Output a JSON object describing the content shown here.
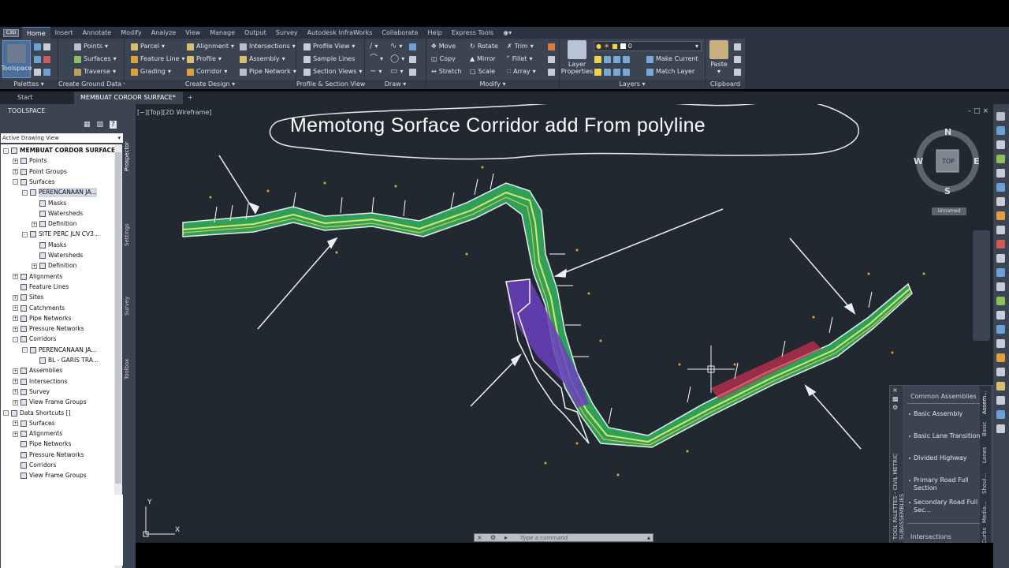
{
  "app_button": "C3D",
  "ribbon_tabs": [
    "Home",
    "Insert",
    "Annotate",
    "Modify",
    "Analyze",
    "View",
    "Manage",
    "Output",
    "Survey",
    "Autodesk InfraWorks",
    "Collaborate",
    "Help",
    "Express Tools"
  ],
  "ribbon": {
    "toolspace": "Toolspace",
    "palettes_title": "Palettes",
    "ground": {
      "title": "Create Ground Data",
      "points": "Points",
      "surfaces": "Surfaces",
      "traverse": "Traverse"
    },
    "design": {
      "title": "Create Design",
      "parcel": "Parcel",
      "feature_line": "Feature Line",
      "grading": "Grading",
      "alignment": "Alignment",
      "profile": "Profile",
      "corridor": "Corridor",
      "intersections": "Intersections",
      "assembly": "Assembly",
      "pipe_network": "Pipe Network"
    },
    "psv": {
      "title": "Profile & Section Views",
      "profile_view": "Profile View",
      "sample_lines": "Sample Lines",
      "section_views": "Section Views"
    },
    "draw": {
      "title": "Draw"
    },
    "modify": {
      "title": "Modify",
      "move": "Move",
      "rotate": "Rotate",
      "trim": "Trim",
      "copy": "Copy",
      "mirror": "Mirror",
      "fillet": "Fillet",
      "stretch": "Stretch",
      "scale": "Scale",
      "array": "Array"
    },
    "layers": {
      "title": "Layers",
      "layer_properties": "Layer Properties",
      "current_layer": "0",
      "make_current": "Make Current",
      "match_layer": "Match Layer"
    },
    "clipboard": {
      "title": "Clipboard",
      "paste": "Paste"
    }
  },
  "doc_tabs": [
    "Start",
    "MEMBUAT CORDOR SURFACE*"
  ],
  "toolspace": {
    "title": "TOOLSPACE",
    "view_select": "Active Drawing View",
    "side_tabs": [
      "Prospector",
      "Settings",
      "Survey",
      "Toolbox"
    ],
    "tree": [
      {
        "label": "MEMBUAT CORDOR SURFACE",
        "level": 0,
        "exp": "-",
        "bold": true
      },
      {
        "label": "Points",
        "level": 1,
        "exp": "+"
      },
      {
        "label": "Point Groups",
        "level": 1,
        "exp": "+"
      },
      {
        "label": "Surfaces",
        "level": 1,
        "exp": "-"
      },
      {
        "label": "PERENCANAAN JA...",
        "level": 2,
        "exp": "-",
        "sel": true
      },
      {
        "label": "Masks",
        "level": 3,
        "exp": ""
      },
      {
        "label": "Watersheds",
        "level": 3,
        "exp": ""
      },
      {
        "label": "Definition",
        "level": 3,
        "exp": "+"
      },
      {
        "label": "SITE PERC JLN CV3...",
        "level": 2,
        "exp": "-"
      },
      {
        "label": "Masks",
        "level": 3,
        "exp": ""
      },
      {
        "label": "Watersheds",
        "level": 3,
        "exp": ""
      },
      {
        "label": "Definition",
        "level": 3,
        "exp": "+"
      },
      {
        "label": "Alignments",
        "level": 1,
        "exp": "+"
      },
      {
        "label": "Feature Lines",
        "level": 1,
        "exp": ""
      },
      {
        "label": "Sites",
        "level": 1,
        "exp": "+"
      },
      {
        "label": "Catchments",
        "level": 1,
        "exp": "+"
      },
      {
        "label": "Pipe Networks",
        "level": 1,
        "exp": "+"
      },
      {
        "label": "Pressure Networks",
        "level": 1,
        "exp": "+"
      },
      {
        "label": "Corridors",
        "level": 1,
        "exp": "-"
      },
      {
        "label": "PERENCANAAN JA...",
        "level": 2,
        "exp": "-"
      },
      {
        "label": "BL - GARIS TRA...",
        "level": 3,
        "exp": ""
      },
      {
        "label": "Assemblies",
        "level": 1,
        "exp": "+"
      },
      {
        "label": "Intersections",
        "level": 1,
        "exp": "+"
      },
      {
        "label": "Survey",
        "level": 1,
        "exp": "+"
      },
      {
        "label": "View Frame Groups",
        "level": 1,
        "exp": "+"
      },
      {
        "label": "Data Shortcuts []",
        "level": 0,
        "exp": "-"
      },
      {
        "label": "Surfaces",
        "level": 1,
        "exp": "+"
      },
      {
        "label": "Alignments",
        "level": 1,
        "exp": "+"
      },
      {
        "label": "Pipe Networks",
        "level": 1,
        "exp": ""
      },
      {
        "label": "Pressure Networks",
        "level": 1,
        "exp": ""
      },
      {
        "label": "Corridors",
        "level": 1,
        "exp": ""
      },
      {
        "label": "View Frame Groups",
        "level": 1,
        "exp": ""
      }
    ]
  },
  "viewport": {
    "label": "[−][Top][2D Wireframe]",
    "annotation": "Memotong Sorface Corridor add From polyline",
    "viewcube": {
      "n": "N",
      "s": "S",
      "e": "E",
      "w": "W",
      "top": "TOP",
      "ucs": "Unnamed"
    },
    "ucs_y": "Y",
    "ucs_x": "X"
  },
  "tool_palette": {
    "side_label": "TOOL PALETTES - CIVIL METRIC SUBASSEMBLIES",
    "heading": "Common Assemblies",
    "items": [
      "Basic Assembly",
      "Basic Lane Transition",
      "Divided Highway",
      "Primary Road Full Section",
      "Secondary Road Full Sec..."
    ],
    "tabs": [
      "Assem...",
      "Basic",
      "Lanes",
      "Shoul...",
      "Media...",
      "Curbs"
    ],
    "footer": "Intersections"
  },
  "command_line": {
    "placeholder": "Type a command"
  },
  "colors": {
    "canvas": "#212830",
    "ribbon": "#3b4453",
    "accent": "#4f8bd6"
  }
}
